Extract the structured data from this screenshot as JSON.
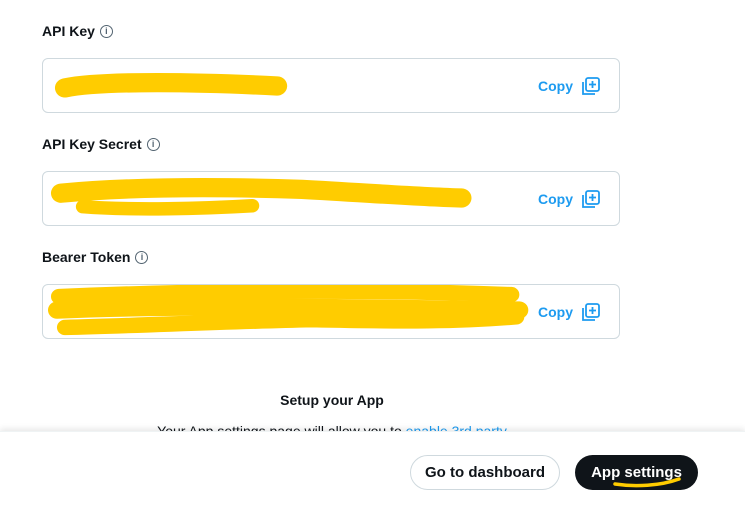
{
  "fields": [
    {
      "label": "API Key",
      "info_icon": "info-icon",
      "copy_label": "Copy",
      "copy_icon": "copy-plus-icon"
    },
    {
      "label": "API Key Secret",
      "info_icon": "info-icon",
      "copy_label": "Copy",
      "copy_icon": "copy-plus-icon"
    },
    {
      "label": "Bearer Token",
      "info_icon": "info-icon",
      "copy_label": "Copy",
      "copy_icon": "copy-plus-icon"
    }
  ],
  "info_glyph": "i",
  "setup": {
    "title": "Setup your App",
    "description": "Your App settings page will allow you to ",
    "link_text": "enable 3rd party"
  },
  "footer": {
    "dashboard_label": "Go to dashboard",
    "app_settings_label": "App settings"
  },
  "colors": {
    "accent": "#1d9bf0",
    "redaction": "#ffcc00",
    "dark_button": "#0f1419"
  }
}
